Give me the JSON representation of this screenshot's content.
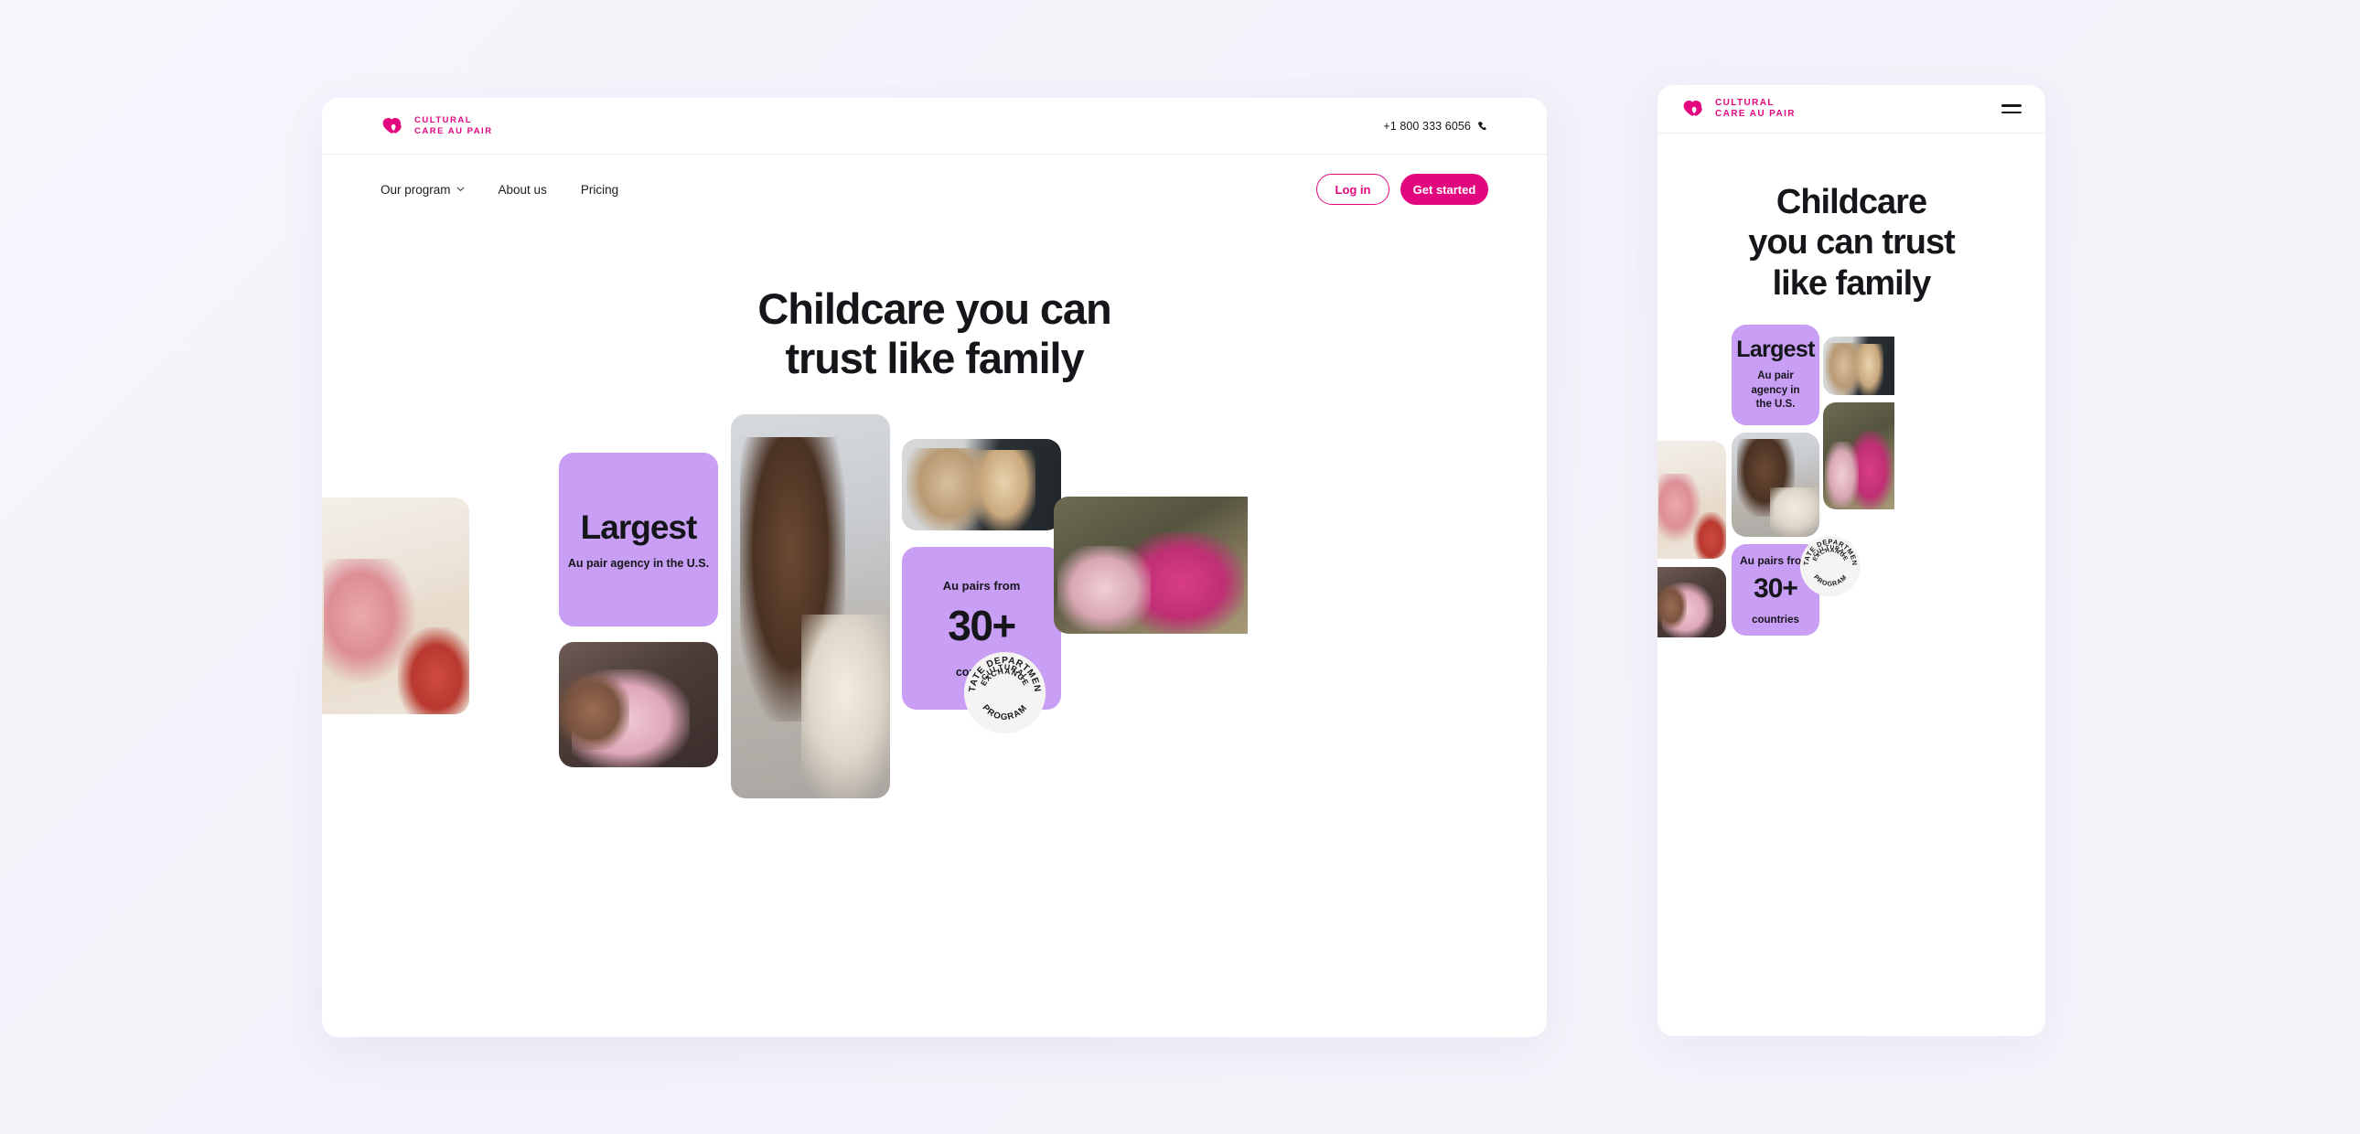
{
  "brand": {
    "name_line1": "CULTURAL",
    "name_line2": "CARE AU PAIR",
    "accent_color": "#e3077f",
    "purple_color": "#c99ef5",
    "logo_icon": "double-heart-logo-icon"
  },
  "desktop": {
    "topbar": {
      "phone": "+1 800 333 6056",
      "phone_icon": "phone-icon"
    },
    "nav": {
      "links": [
        {
          "label": "Our program",
          "has_dropdown": true,
          "icon": "chevron-down-icon"
        },
        {
          "label": "About us",
          "has_dropdown": false
        },
        {
          "label": "Pricing",
          "has_dropdown": false
        }
      ],
      "login_label": "Log in",
      "get_started_label": "Get started"
    },
    "hero": {
      "title_line1": "Childcare you can",
      "title_line2": "trust like family"
    },
    "cards": {
      "largest": {
        "headline": "Largest",
        "sub": "Au pair agency in the U.S."
      },
      "countries": {
        "top": "Au pairs from",
        "number": "30+",
        "bottom": "countries"
      }
    },
    "seal": {
      "outer_text": "STATE DEPARTMENT",
      "mid_line1": "CULTURAL",
      "mid_line2": "EXCHANGE",
      "bottom_text": "PROGRAM"
    },
    "photos": [
      {
        "alt": "au-pair-playing-with-baby-and-pink-toy"
      },
      {
        "alt": "au-pair-hugging-laughing-child-in-pink-hoodie"
      },
      {
        "alt": "au-pair-with-clapping-toddler-on-couch"
      },
      {
        "alt": "au-pair-with-two-girls-carving-pumpkin"
      },
      {
        "alt": "au-pair-carrying-girl-outdoors-in-pink-shirt"
      }
    ]
  },
  "mobile": {
    "topbar": {
      "menu_icon": "hamburger-menu-icon"
    },
    "hero": {
      "title_line1": "Childcare",
      "title_line2": "you can trust",
      "title_line3": "like family"
    },
    "cards": {
      "largest": {
        "headline": "Largest",
        "sub": "Au pair agency in the U.S."
      },
      "countries": {
        "top": "Au pairs from",
        "number": "30+",
        "bottom": "countries"
      }
    },
    "seal": {
      "outer_text": "STATE DEPARTMENT",
      "mid_line1": "CULTURAL",
      "mid_line2": "EXCHANGE",
      "bottom_text": "PROGRAM"
    }
  }
}
